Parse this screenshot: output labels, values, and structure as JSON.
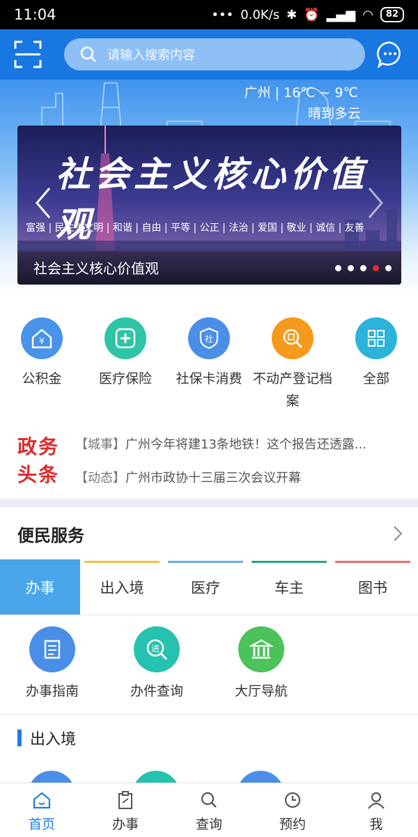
{
  "status_bar": {
    "time": "11:04",
    "network": "0.0K/s",
    "battery": "82"
  },
  "header": {
    "search_placeholder": "请输入搜索内容"
  },
  "weather": {
    "city": "广州",
    "temp": "16℃ ~ 9℃",
    "desc": "晴到多云"
  },
  "banner": {
    "headline": "社会主义核心价值观",
    "values": "富强 | 民主 | 文明 | 和谐 | 自由 | 平等 | 公正 | 法治 | 爱国 | 敬业 | 诚信 | 友善",
    "caption": "社会主义核心价值观",
    "dot_count": 5,
    "active_dot": 4
  },
  "services": [
    {
      "label": "公积金",
      "icon": "housing-fund-icon",
      "color": "#4a93ea"
    },
    {
      "label": "医疗保险",
      "icon": "medical-cross-icon",
      "color": "#2ec4a6"
    },
    {
      "label": "社保卡消费",
      "icon": "social-card-icon",
      "color": "#4a8ee8"
    },
    {
      "label": "不动产登记档案",
      "icon": "property-search-icon",
      "color": "#f59a1d"
    },
    {
      "label": "全部",
      "icon": "grid-icon",
      "color": "#2bb3d9"
    }
  ],
  "news": {
    "brand_line1": "政务",
    "brand_line2": "头条",
    "items": [
      {
        "tag": "【城事】",
        "text": "广州今年将建13条地铁！这个报告还透露..."
      },
      {
        "tag": "【动态】",
        "text": "广州市政协十三届三次会议开幕"
      }
    ]
  },
  "convenience": {
    "title": "便民服务",
    "tabs": [
      {
        "label": "办事",
        "bar": ""
      },
      {
        "label": "出入境",
        "bar": "#f2c23e"
      },
      {
        "label": "医疗",
        "bar": "#6fa8e8"
      },
      {
        "label": "车主",
        "bar": "#2aa57a"
      },
      {
        "label": "图书",
        "bar": "#ef6a6a"
      }
    ],
    "quick": [
      {
        "label": "办事指南",
        "icon": "guide-scroll-icon",
        "color": "#4a8ee8"
      },
      {
        "label": "办件查询",
        "icon": "search-progress-icon",
        "color": "#27c1b0"
      },
      {
        "label": "大厅导航",
        "icon": "hall-building-icon",
        "color": "#4cc25a"
      }
    ],
    "section2_title": "出入境"
  },
  "tabbar": [
    {
      "label": "首页",
      "icon": "home-icon",
      "active": true
    },
    {
      "label": "办事",
      "icon": "clipboard-icon",
      "active": false
    },
    {
      "label": "查询",
      "icon": "search-icon",
      "active": false
    },
    {
      "label": "预约",
      "icon": "clock-icon",
      "active": false
    },
    {
      "label": "我",
      "icon": "user-icon",
      "active": false
    }
  ]
}
